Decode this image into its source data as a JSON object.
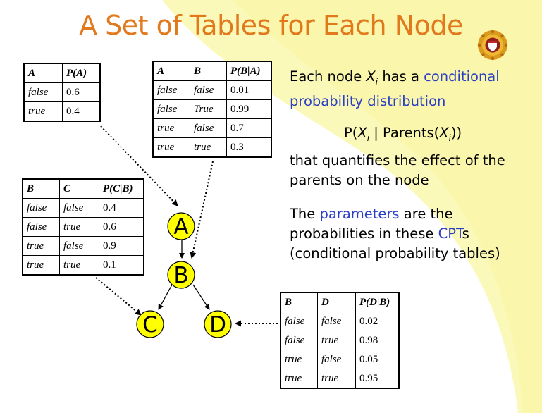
{
  "title": "A Set of Tables for Each Node",
  "colors": {
    "title": "#e07a1c",
    "node_fill": "#ffff00",
    "link_blue": "#2b3fc4"
  },
  "tables": {
    "a": {
      "headers": [
        "A",
        "P(A)"
      ],
      "rows": [
        [
          "false",
          "0.6"
        ],
        [
          "true",
          "0.4"
        ]
      ]
    },
    "ba": {
      "headers": [
        "A",
        "B",
        "P(B|A)"
      ],
      "rows": [
        [
          "false",
          "false",
          "0.01"
        ],
        [
          "false",
          "True",
          "0.99"
        ],
        [
          "true",
          "false",
          "0.7"
        ],
        [
          "true",
          "true",
          "0.3"
        ]
      ]
    },
    "cb": {
      "headers": [
        "B",
        "C",
        "P(C|B)"
      ],
      "rows": [
        [
          "false",
          "false",
          "0.4"
        ],
        [
          "false",
          "true",
          "0.6"
        ],
        [
          "true",
          "false",
          "0.9"
        ],
        [
          "true",
          "true",
          "0.1"
        ]
      ]
    },
    "db": {
      "headers": [
        "B",
        "D",
        "P(D|B)"
      ],
      "rows": [
        [
          "false",
          "false",
          "0.02"
        ],
        [
          "false",
          "true",
          "0.98"
        ],
        [
          "true",
          "false",
          "0.05"
        ],
        [
          "true",
          "true",
          "0.95"
        ]
      ]
    }
  },
  "nodes": {
    "a": "A",
    "b": "B",
    "c": "C",
    "d": "D"
  },
  "text": {
    "p1_pre": "Each node ",
    "p1_var": "X",
    "p1_sub": "i",
    "p1_mid": " has a ",
    "p1_link": "conditional probability distribution",
    "formula_pre": "P(",
    "formula_var": "X",
    "formula_sub": "i",
    "formula_mid": " | Parents(",
    "formula_var2": "X",
    "formula_sub2": "i",
    "formula_end": "))",
    "p2": "that quantifies the effect of the parents on the node",
    "p3_pre": "The ",
    "p3_link1": "parameters",
    "p3_mid": " are the probabilities in these ",
    "p3_link2": "CPT",
    "p3_post": "s (conditional probability tables)"
  }
}
